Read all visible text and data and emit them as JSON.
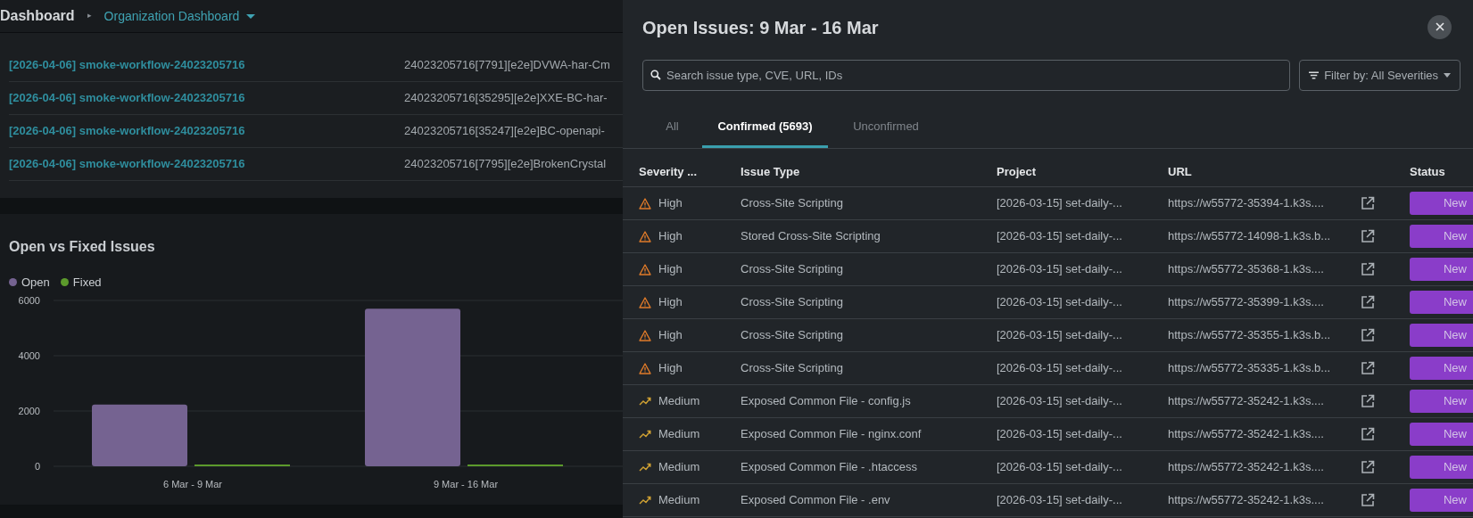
{
  "breadcrumb": [
    {
      "label": "Dashboard",
      "current": false
    },
    {
      "label": "Organization Dashboard",
      "current": true
    }
  ],
  "breadcrumb_separator": "▸",
  "runs": [
    {
      "name": "[2026-04-06] smoke-workflow-24023205716",
      "target": "24023205716[7791][e2e]DVWA-har-Cm"
    },
    {
      "name": "[2026-04-06] smoke-workflow-24023205716",
      "target": "24023205716[35295][e2e]XXE-BC-har-"
    },
    {
      "name": "[2026-04-06] smoke-workflow-24023205716",
      "target": "24023205716[35247][e2e]BC-openapi-"
    },
    {
      "name": "[2026-04-06] smoke-workflow-24023205716",
      "target": "24023205716[7795][e2e]BrokenCrystal"
    }
  ],
  "chart_card": {
    "title": "Open vs Fixed Issues",
    "chart_data": {
      "type": "bar",
      "categories": [
        "6 Mar - 9 Mar",
        "9 Mar - 16 Mar"
      ],
      "ylim": [
        0,
        6000
      ],
      "yticks": [
        0,
        2000,
        4000,
        6000
      ],
      "series": [
        {
          "name": "Open",
          "color": "#756391",
          "values": [
            2230,
            5700
          ]
        },
        {
          "name": "Fixed",
          "color": "#5c9a2c",
          "values": [
            0,
            0
          ]
        }
      ]
    }
  },
  "issues_panel": {
    "title": "Open Issues: 9 Mar - 16 Mar",
    "search": {
      "placeholder": "Search issue type, CVE, URL, IDs"
    },
    "filter": "Filter by: All Severities",
    "tabs": [
      {
        "label": "All",
        "selected": false
      },
      {
        "label": "Confirmed (5693)",
        "selected": true
      },
      {
        "label": "Unconfirmed",
        "selected": false
      }
    ],
    "columns": [
      "Severity ...",
      "Issue Type",
      "Project",
      "URL",
      "Status"
    ],
    "rows": [
      {
        "severity": "High",
        "kind": "high",
        "issue_type": "Cross-Site Scripting",
        "project": "[2026-03-15] set-daily-...",
        "url": "https://w55772-35394-1.k3s....",
        "status": "New"
      },
      {
        "severity": "High",
        "kind": "high",
        "issue_type": "Stored Cross-Site Scripting",
        "project": "[2026-03-15] set-daily-...",
        "url": "https://w55772-14098-1.k3s.b...",
        "status": "New"
      },
      {
        "severity": "High",
        "kind": "high",
        "issue_type": "Cross-Site Scripting",
        "project": "[2026-03-15] set-daily-...",
        "url": "https://w55772-35368-1.k3s....",
        "status": "New"
      },
      {
        "severity": "High",
        "kind": "high",
        "issue_type": "Cross-Site Scripting",
        "project": "[2026-03-15] set-daily-...",
        "url": "https://w55772-35399-1.k3s....",
        "status": "New"
      },
      {
        "severity": "High",
        "kind": "high",
        "issue_type": "Cross-Site Scripting",
        "project": "[2026-03-15] set-daily-...",
        "url": "https://w55772-35355-1.k3s.b...",
        "status": "New"
      },
      {
        "severity": "High",
        "kind": "high",
        "issue_type": "Cross-Site Scripting",
        "project": "[2026-03-15] set-daily-...",
        "url": "https://w55772-35335-1.k3s.b...",
        "status": "New"
      },
      {
        "severity": "Medium",
        "kind": "medium",
        "issue_type": "Exposed Common File - config.js",
        "project": "[2026-03-15] set-daily-...",
        "url": "https://w55772-35242-1.k3s....",
        "status": "New"
      },
      {
        "severity": "Medium",
        "kind": "medium",
        "issue_type": "Exposed Common File - nginx.conf",
        "project": "[2026-03-15] set-daily-...",
        "url": "https://w55772-35242-1.k3s....",
        "status": "New"
      },
      {
        "severity": "Medium",
        "kind": "medium",
        "issue_type": "Exposed Common File - .htaccess",
        "project": "[2026-03-15] set-daily-...",
        "url": "https://w55772-35242-1.k3s....",
        "status": "New"
      },
      {
        "severity": "Medium",
        "kind": "medium",
        "issue_type": "Exposed Common File - .env",
        "project": "[2026-03-15] set-daily-...",
        "url": "https://w55772-35242-1.k3s....",
        "status": "New"
      }
    ]
  }
}
